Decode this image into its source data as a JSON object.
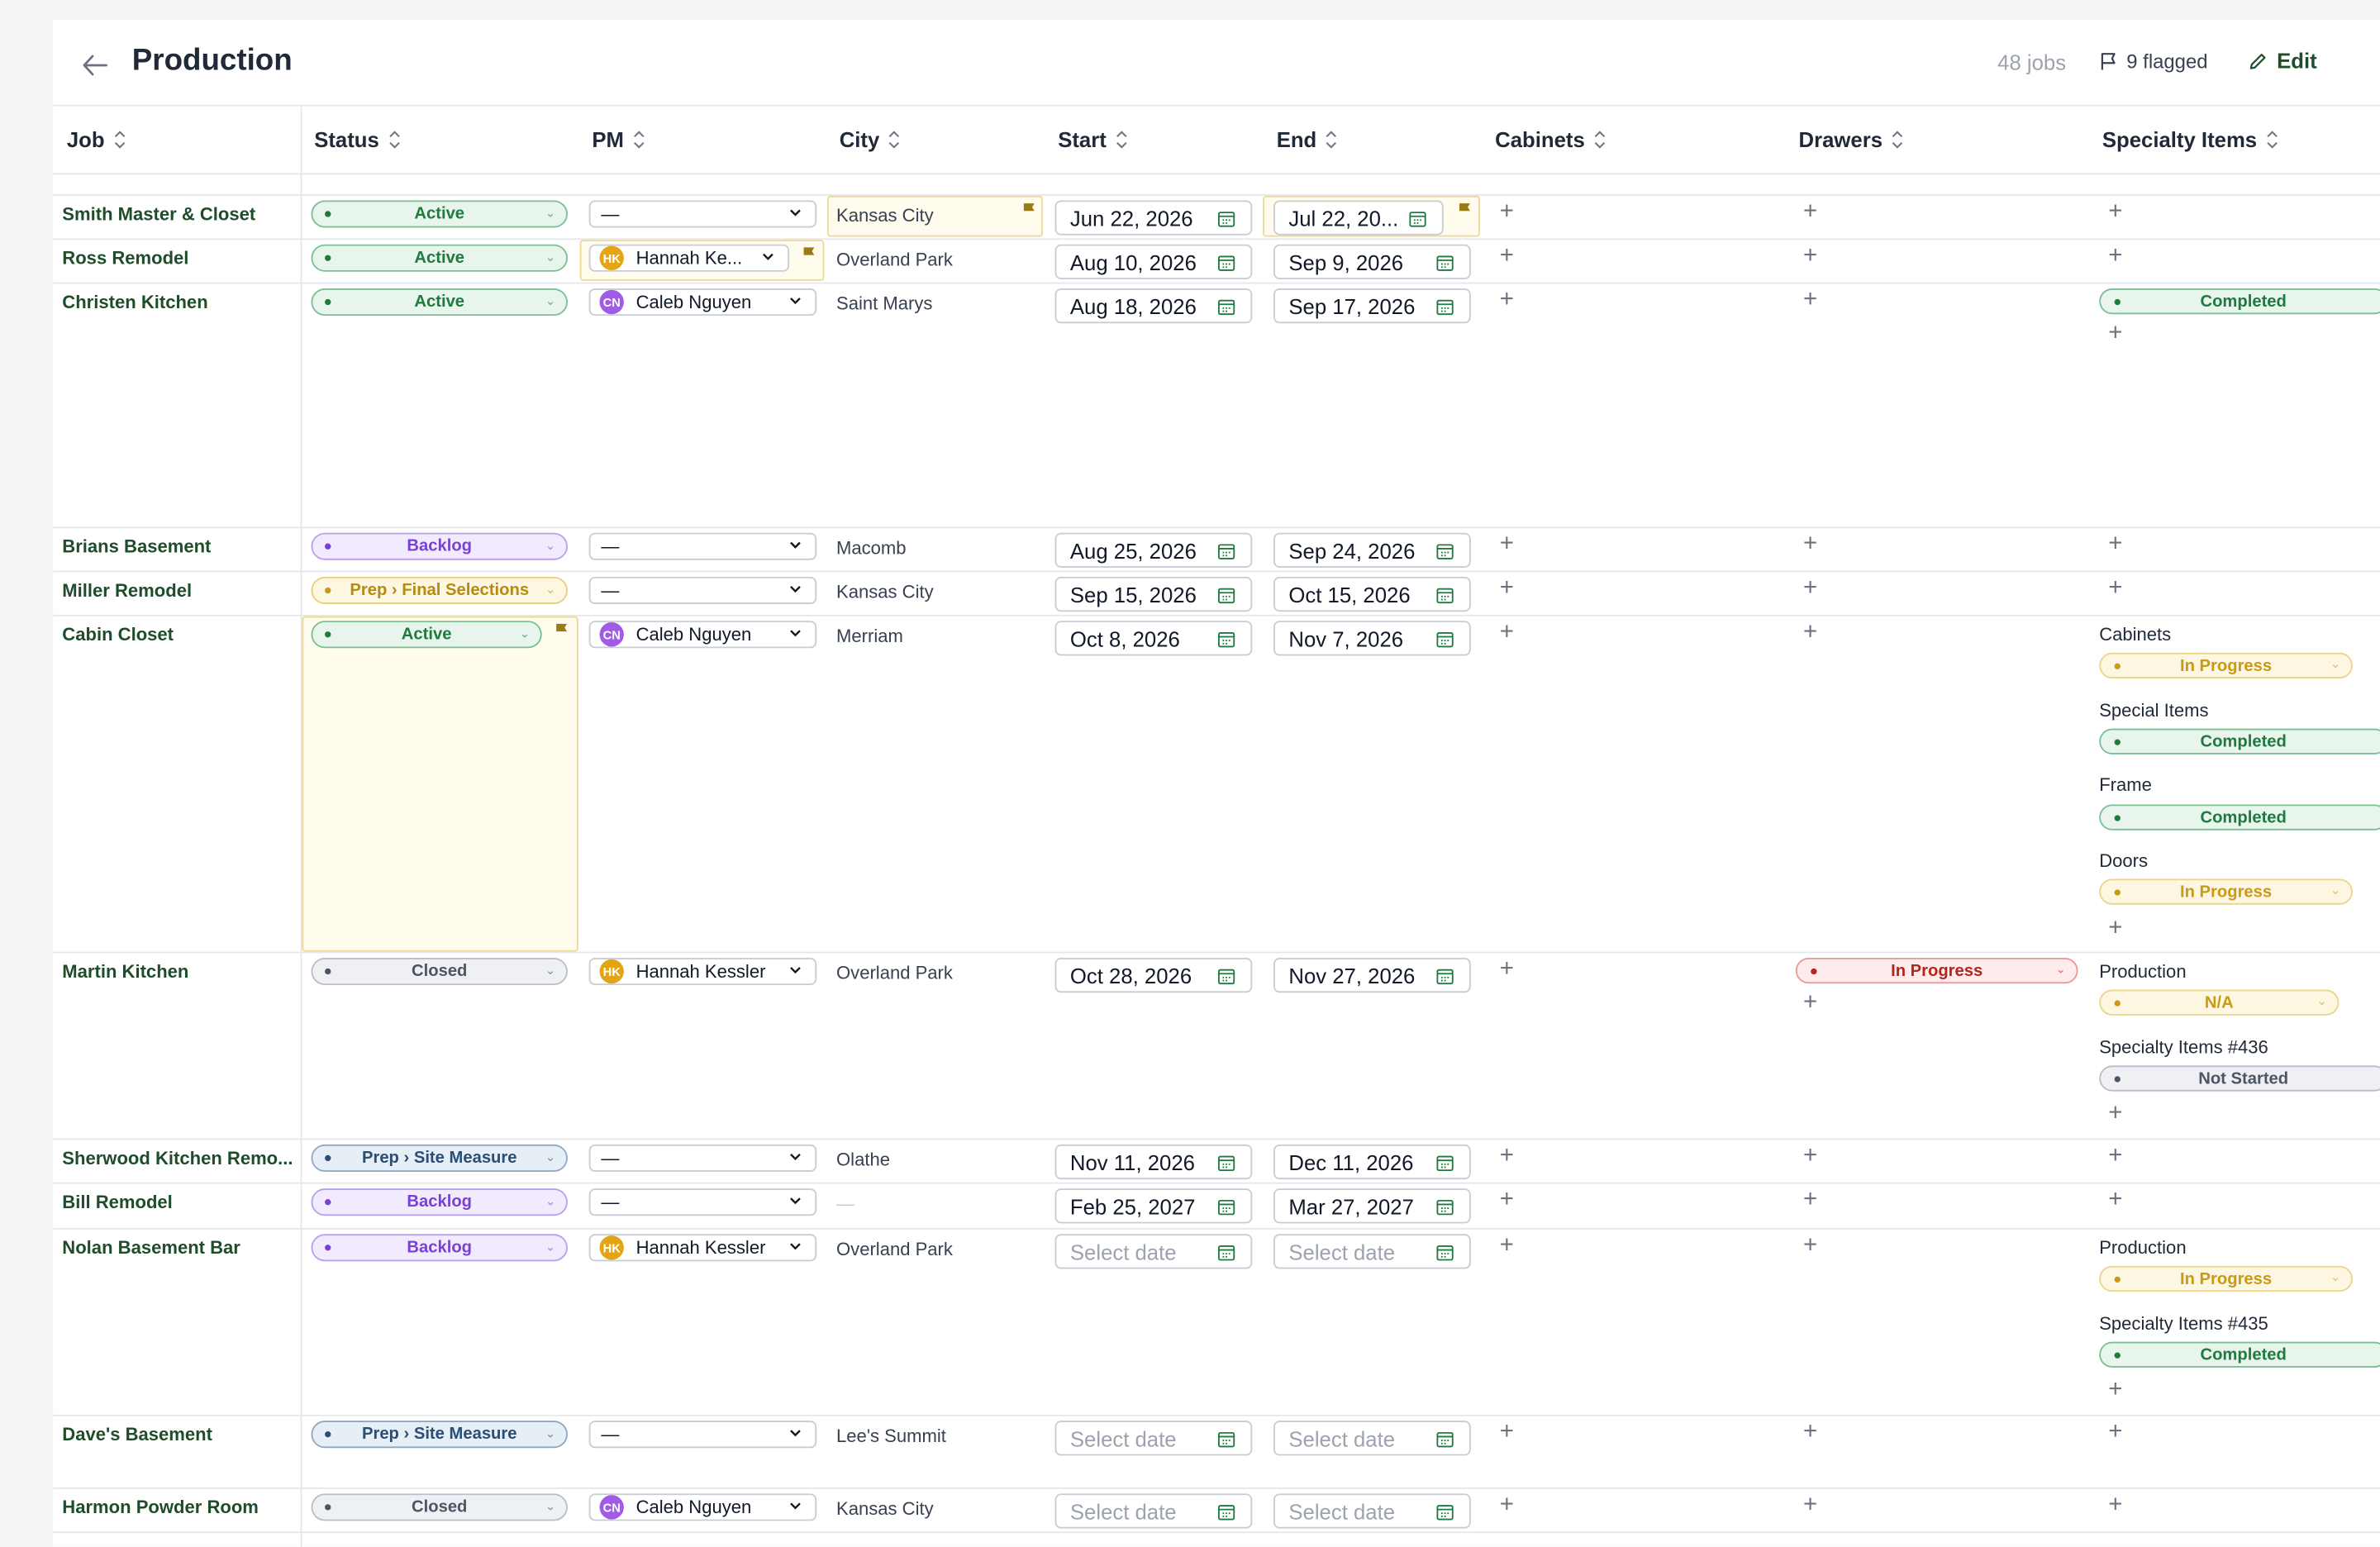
{
  "header": {
    "title": "Production",
    "job_count": "48 jobs",
    "flagged": "9 flagged",
    "edit_label": "Edit"
  },
  "columns": [
    "Job",
    "Status",
    "PM",
    "City",
    "Start",
    "End",
    "Cabinets",
    "Drawers",
    "Specialty Items"
  ],
  "placeholders": {
    "date": "Select date",
    "pm_empty": "—",
    "city_empty": "—"
  },
  "rows": [
    {
      "job": "Smith Master & Closet",
      "status": "Active",
      "pm": "—",
      "city": "Kansas City",
      "start": "Jun 22, 2026",
      "end": "Jul 22, 20..."
    },
    {
      "job": "Ross Remodel",
      "status": "Active",
      "pm": "Hannah Ke...",
      "pm_initials": "HK",
      "city": "Overland Park",
      "start": "Aug 10, 2026",
      "end": "Sep 9, 2026"
    },
    {
      "job": "Christen Kitchen",
      "status": "Active",
      "pm": "Caleb Nguyen",
      "pm_initials": "CN",
      "city": "Saint Marys",
      "start": "Aug 18, 2026",
      "end": "Sep 17, 2026",
      "specialty": [
        {
          "status": "Completed"
        }
      ]
    },
    {
      "job": "Brians Basement",
      "status": "Backlog",
      "pm": "—",
      "city": "Macomb",
      "start": "Aug 25, 2026",
      "end": "Sep 24, 2026"
    },
    {
      "job": "Miller Remodel",
      "status": "Prep › Final Selections",
      "pm": "—",
      "city": "Kansas City",
      "start": "Sep 15, 2026",
      "end": "Oct 15, 2026"
    },
    {
      "job": "Cabin Closet",
      "status": "Active",
      "pm": "Caleb Nguyen",
      "pm_initials": "CN",
      "city": "Merriam",
      "start": "Oct 8, 2026",
      "end": "Nov 7, 2026",
      "specialty": [
        {
          "label": "Cabinets",
          "status": "In Progress"
        },
        {
          "label": "Special Items",
          "status": "Completed"
        },
        {
          "label": "Frame",
          "status": "Completed"
        },
        {
          "label": "Doors",
          "status": "In Progress"
        }
      ]
    },
    {
      "job": "Martin Kitchen",
      "status": "Closed",
      "pm": "Hannah Kessler",
      "pm_initials": "HK",
      "city": "Overland Park",
      "start": "Oct 28, 2026",
      "end": "Nov 27, 2026",
      "drawers": "In Progress",
      "specialty": [
        {
          "label": "Production",
          "status": "N/A"
        },
        {
          "label": "Specialty Items #436",
          "status": "Not Started"
        }
      ]
    },
    {
      "job": "Sherwood Kitchen Remo...",
      "status": "Prep › Site Measure",
      "pm": "—",
      "city": "Olathe",
      "start": "Nov 11, 2026",
      "end": "Dec 11, 2026"
    },
    {
      "job": "Bill Remodel",
      "status": "Backlog",
      "pm": "—",
      "city": "—",
      "start": "Feb 25, 2027",
      "end": "Mar 27, 2027"
    },
    {
      "job": "Nolan Basement Bar",
      "status": "Backlog",
      "pm": "Hannah Kessler",
      "pm_initials": "HK",
      "city": "Overland Park",
      "start": "Select date",
      "end": "Select date",
      "specialty": [
        {
          "label": "Production",
          "status": "In Progress"
        },
        {
          "label": "Specialty Items #435",
          "status": "Completed"
        }
      ]
    },
    {
      "job": "Dave's Basement",
      "status": "Prep › Site Measure",
      "pm": "—",
      "city": "Lee's Summit",
      "start": "Select date",
      "end": "Select date"
    },
    {
      "job": "Harmon Powder Room",
      "status": "Closed",
      "pm": "Caleb Nguyen",
      "pm_initials": "CN",
      "city": "Kansas City",
      "start": "Select date",
      "end": "Select date"
    }
  ],
  "colors": {
    "accent_green": "#1f4d2b",
    "active": "#1f7a3f",
    "backlog": "#7a3fd6",
    "prep_final": "#c99a14",
    "closed": "#4b5563",
    "prep_site": "#2c4e72",
    "in_progress_red": "#b3261e",
    "flag": "#9a7a14"
  },
  "icons": [
    "back-arrow-icon",
    "flag-icon",
    "pencil-icon",
    "sort-icon",
    "chevron-down-icon",
    "calendar-icon",
    "plus-icon"
  ]
}
